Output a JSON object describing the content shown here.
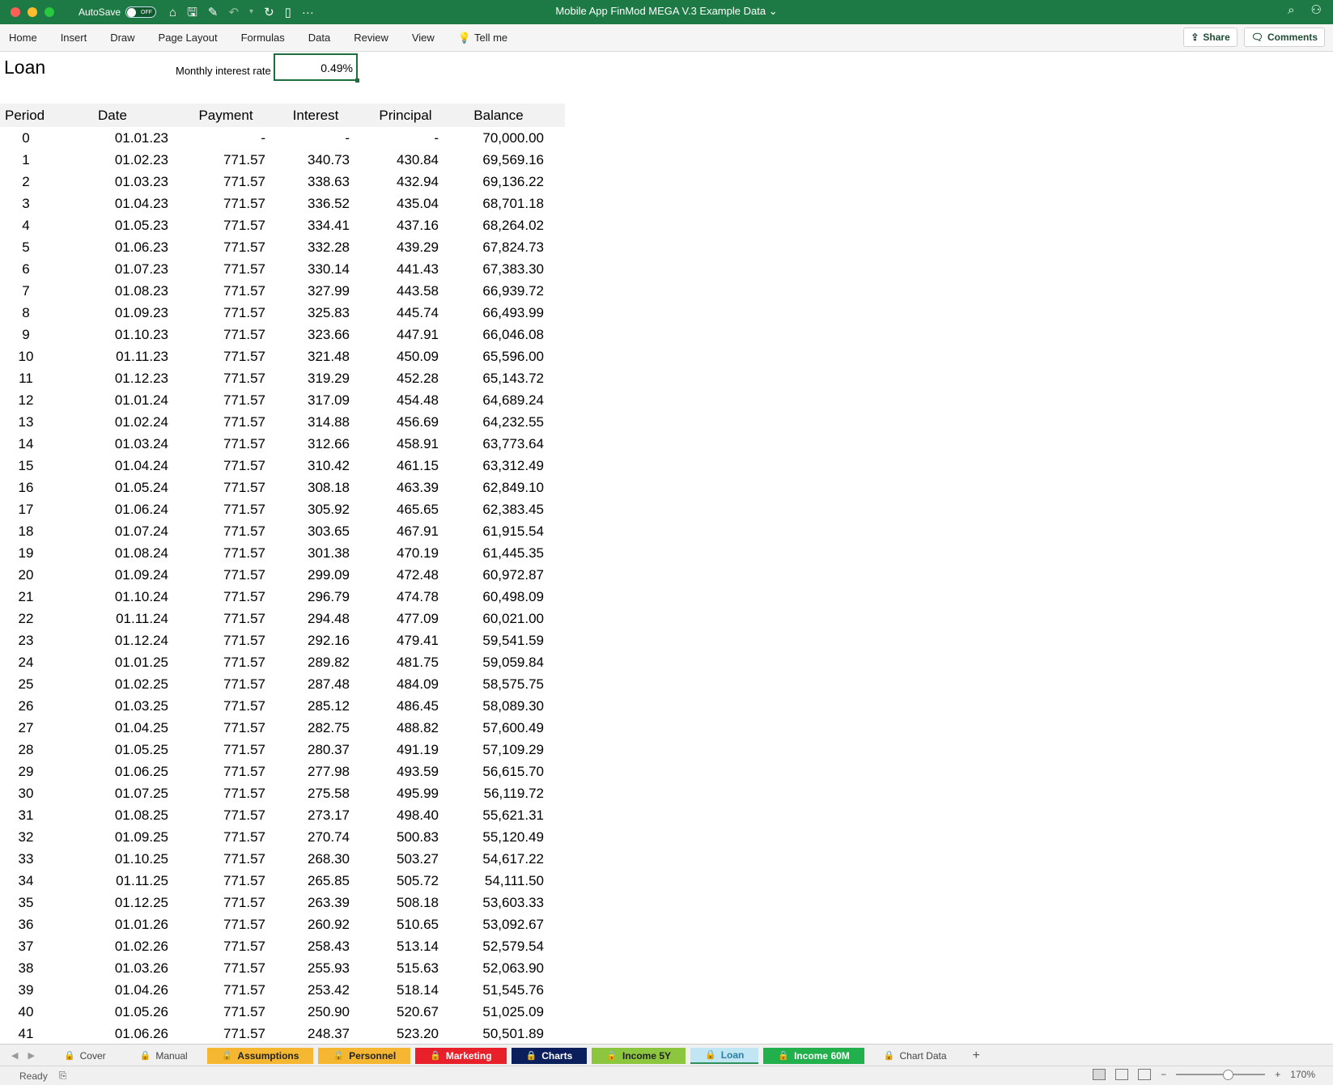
{
  "titlebar": {
    "autosave_label": "AutoSave",
    "autosave_state": "OFF",
    "document_title": "Mobile App FinMod MEGA V.3 Example Data",
    "chevron": "⌄"
  },
  "ribbon": {
    "tabs": [
      "Home",
      "Insert",
      "Draw",
      "Page Layout",
      "Formulas",
      "Data",
      "Review",
      "View"
    ],
    "tell_me": "Tell me",
    "share": "Share",
    "comments": "Comments"
  },
  "sheet": {
    "title": "Loan",
    "rate_label": "Monthly interest rate",
    "rate_value": "0.49%",
    "headers": {
      "period": "Period",
      "date": "Date",
      "payment": "Payment",
      "interest": "Interest",
      "principal": "Principal",
      "balance": "Balance"
    },
    "rows": [
      [
        "0",
        "01.01.23",
        "-",
        "-",
        "-",
        "70,000.00"
      ],
      [
        "1",
        "01.02.23",
        "771.57",
        "340.73",
        "430.84",
        "69,569.16"
      ],
      [
        "2",
        "01.03.23",
        "771.57",
        "338.63",
        "432.94",
        "69,136.22"
      ],
      [
        "3",
        "01.04.23",
        "771.57",
        "336.52",
        "435.04",
        "68,701.18"
      ],
      [
        "4",
        "01.05.23",
        "771.57",
        "334.41",
        "437.16",
        "68,264.02"
      ],
      [
        "5",
        "01.06.23",
        "771.57",
        "332.28",
        "439.29",
        "67,824.73"
      ],
      [
        "6",
        "01.07.23",
        "771.57",
        "330.14",
        "441.43",
        "67,383.30"
      ],
      [
        "7",
        "01.08.23",
        "771.57",
        "327.99",
        "443.58",
        "66,939.72"
      ],
      [
        "8",
        "01.09.23",
        "771.57",
        "325.83",
        "445.74",
        "66,493.99"
      ],
      [
        "9",
        "01.10.23",
        "771.57",
        "323.66",
        "447.91",
        "66,046.08"
      ],
      [
        "10",
        "01.11.23",
        "771.57",
        "321.48",
        "450.09",
        "65,596.00"
      ],
      [
        "11",
        "01.12.23",
        "771.57",
        "319.29",
        "452.28",
        "65,143.72"
      ],
      [
        "12",
        "01.01.24",
        "771.57",
        "317.09",
        "454.48",
        "64,689.24"
      ],
      [
        "13",
        "01.02.24",
        "771.57",
        "314.88",
        "456.69",
        "64,232.55"
      ],
      [
        "14",
        "01.03.24",
        "771.57",
        "312.66",
        "458.91",
        "63,773.64"
      ],
      [
        "15",
        "01.04.24",
        "771.57",
        "310.42",
        "461.15",
        "63,312.49"
      ],
      [
        "16",
        "01.05.24",
        "771.57",
        "308.18",
        "463.39",
        "62,849.10"
      ],
      [
        "17",
        "01.06.24",
        "771.57",
        "305.92",
        "465.65",
        "62,383.45"
      ],
      [
        "18",
        "01.07.24",
        "771.57",
        "303.65",
        "467.91",
        "61,915.54"
      ],
      [
        "19",
        "01.08.24",
        "771.57",
        "301.38",
        "470.19",
        "61,445.35"
      ],
      [
        "20",
        "01.09.24",
        "771.57",
        "299.09",
        "472.48",
        "60,972.87"
      ],
      [
        "21",
        "01.10.24",
        "771.57",
        "296.79",
        "474.78",
        "60,498.09"
      ],
      [
        "22",
        "01.11.24",
        "771.57",
        "294.48",
        "477.09",
        "60,021.00"
      ],
      [
        "23",
        "01.12.24",
        "771.57",
        "292.16",
        "479.41",
        "59,541.59"
      ],
      [
        "24",
        "01.01.25",
        "771.57",
        "289.82",
        "481.75",
        "59,059.84"
      ],
      [
        "25",
        "01.02.25",
        "771.57",
        "287.48",
        "484.09",
        "58,575.75"
      ],
      [
        "26",
        "01.03.25",
        "771.57",
        "285.12",
        "486.45",
        "58,089.30"
      ],
      [
        "27",
        "01.04.25",
        "771.57",
        "282.75",
        "488.82",
        "57,600.49"
      ],
      [
        "28",
        "01.05.25",
        "771.57",
        "280.37",
        "491.19",
        "57,109.29"
      ],
      [
        "29",
        "01.06.25",
        "771.57",
        "277.98",
        "493.59",
        "56,615.70"
      ],
      [
        "30",
        "01.07.25",
        "771.57",
        "275.58",
        "495.99",
        "56,119.72"
      ],
      [
        "31",
        "01.08.25",
        "771.57",
        "273.17",
        "498.40",
        "55,621.31"
      ],
      [
        "32",
        "01.09.25",
        "771.57",
        "270.74",
        "500.83",
        "55,120.49"
      ],
      [
        "33",
        "01.10.25",
        "771.57",
        "268.30",
        "503.27",
        "54,617.22"
      ],
      [
        "34",
        "01.11.25",
        "771.57",
        "265.85",
        "505.72",
        "54,111.50"
      ],
      [
        "35",
        "01.12.25",
        "771.57",
        "263.39",
        "508.18",
        "53,603.33"
      ],
      [
        "36",
        "01.01.26",
        "771.57",
        "260.92",
        "510.65",
        "53,092.67"
      ],
      [
        "37",
        "01.02.26",
        "771.57",
        "258.43",
        "513.14",
        "52,579.54"
      ],
      [
        "38",
        "01.03.26",
        "771.57",
        "255.93",
        "515.63",
        "52,063.90"
      ],
      [
        "39",
        "01.04.26",
        "771.57",
        "253.42",
        "518.14",
        "51,545.76"
      ],
      [
        "40",
        "01.05.26",
        "771.57",
        "250.90",
        "520.67",
        "51,025.09"
      ],
      [
        "41",
        "01.06.26",
        "771.57",
        "248.37",
        "523.20",
        "50,501.89"
      ]
    ]
  },
  "sheet_tabs": [
    {
      "label": "Cover",
      "color": "#f0f0f0",
      "text": "#444",
      "active": false
    },
    {
      "label": "Manual",
      "color": "#f0f0f0",
      "text": "#444",
      "active": false
    },
    {
      "label": "Assumptions",
      "color": "#f5b731",
      "text": "#222",
      "active": false
    },
    {
      "label": "Personnel",
      "color": "#f5b731",
      "text": "#222",
      "active": false
    },
    {
      "label": "Marketing",
      "color": "#e8202a",
      "text": "#ffffff",
      "active": false
    },
    {
      "label": "Charts",
      "color": "#0b1f5c",
      "text": "#ffffff",
      "active": false
    },
    {
      "label": "Income 5Y",
      "color": "#8cc63f",
      "text": "#222",
      "active": false
    },
    {
      "label": "Loan",
      "color": "#bfe6f2",
      "text": "#2a7fa8",
      "active": true
    },
    {
      "label": "Income 60M",
      "color": "#21b04b",
      "text": "#ffffff",
      "active": false
    },
    {
      "label": "Chart Data",
      "color": "#f0f0f0",
      "text": "#444",
      "active": false
    }
  ],
  "status": {
    "ready": "Ready",
    "zoom": "170%"
  }
}
